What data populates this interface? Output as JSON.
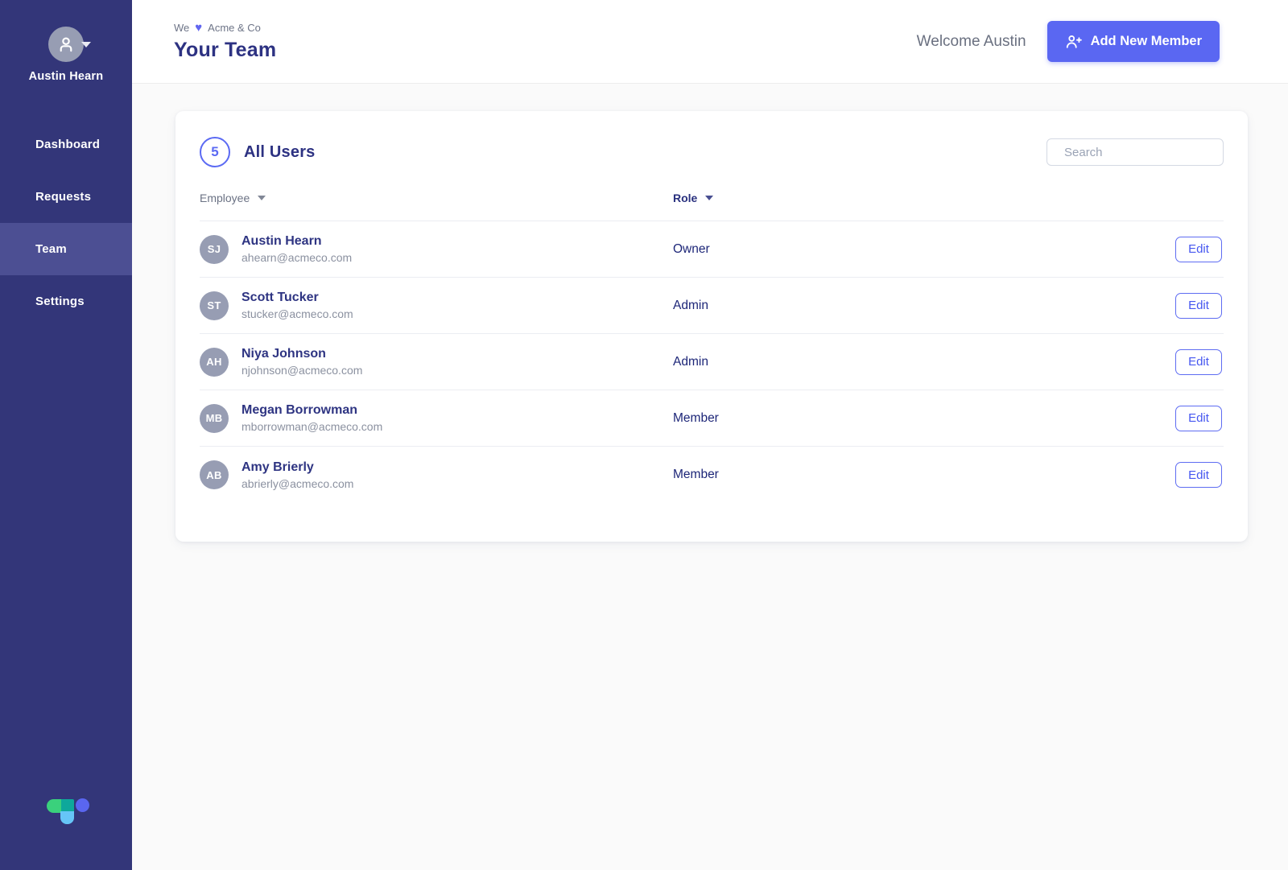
{
  "sidebar": {
    "user_name": "Austin Hearn",
    "items": [
      {
        "label": "Dashboard",
        "active": false
      },
      {
        "label": "Requests",
        "active": false
      },
      {
        "label": "Team",
        "active": true
      },
      {
        "label": "Settings",
        "active": false
      }
    ]
  },
  "header": {
    "breadcrumb_pre": "We",
    "breadcrumb_heart": "♥",
    "breadcrumb_post": "Acme & Co",
    "title": "Your Team",
    "welcome": "Welcome Austin",
    "add_button_label": "Add New Member"
  },
  "card": {
    "count": "5",
    "title": "All Users",
    "search_placeholder": "Search",
    "columns": {
      "employee": "Employee",
      "role": "Role"
    },
    "edit_label": "Edit",
    "users": [
      {
        "initials": "SJ",
        "name": "Austin Hearn",
        "email": "ahearn@acmeco.com",
        "role": "Owner"
      },
      {
        "initials": "ST",
        "name": "Scott Tucker",
        "email": "stucker@acmeco.com",
        "role": "Admin"
      },
      {
        "initials": "AH",
        "name": "Niya Johnson",
        "email": "njohnson@acmeco.com",
        "role": "Admin"
      },
      {
        "initials": "MB",
        "name": "Megan Borrowman",
        "email": "mborrowman@acmeco.com",
        "role": "Member"
      },
      {
        "initials": "AB",
        "name": "Amy Brierly",
        "email": "abrierly@acmeco.com",
        "role": "Member"
      }
    ]
  },
  "colors": {
    "sidebar_bg": "#333679",
    "sidebar_active": "#4c4f93",
    "accent": "#5a67f2",
    "title_navy": "#2d3282",
    "role_navy": "#1d2678",
    "avatar_gray": "#979db3",
    "logo_green": "#3ad17c",
    "logo_teal": "#0ea89b",
    "logo_lightblue": "#66c5f7",
    "logo_indigo": "#5a66f0"
  }
}
